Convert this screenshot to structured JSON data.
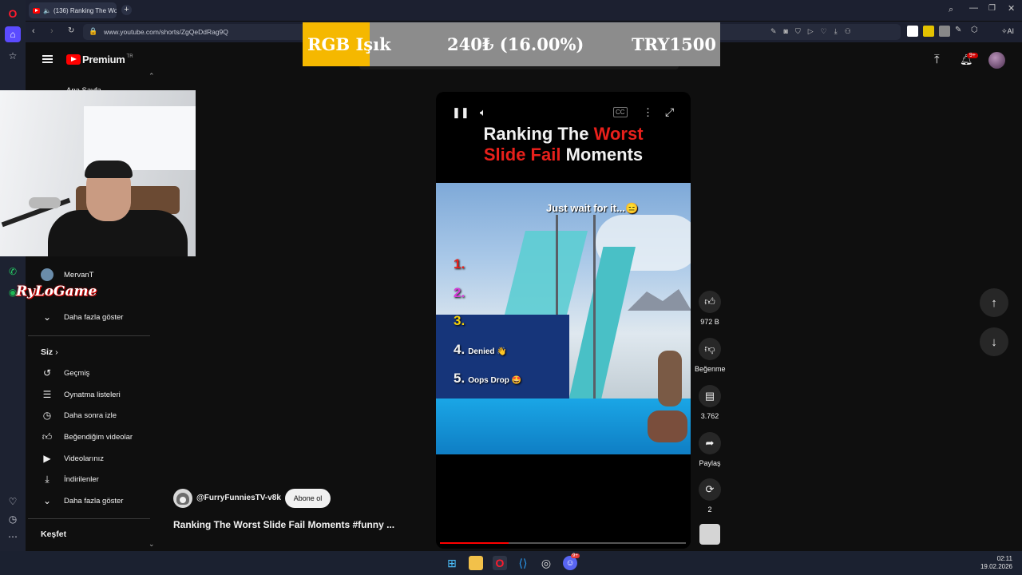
{
  "browser": {
    "tab_title": "(136) Ranking The Wo",
    "url": "www.youtube.com/shorts/ZgQeDdRag9Q",
    "ai_label": "AI"
  },
  "overlay_banner": {
    "label": "RGB Işık",
    "amount": "240₺ (16.00%)",
    "goal": "TRY1500",
    "progress_percent": 16,
    "colors": {
      "fill": "#f5b800",
      "track": "#8c8c8c"
    }
  },
  "youtube": {
    "brand": "Premium",
    "country": "TR",
    "notification_badge": "9+"
  },
  "sidebar": {
    "partial_top_item": "Ana Sayfa",
    "subscriptions": [
      {
        "label": "MervanT"
      }
    ],
    "show_more_1": "Daha fazla göster",
    "you_section_title": "Siz",
    "you_items": [
      {
        "icon": "history-icon",
        "label": "Geçmiş"
      },
      {
        "icon": "playlist-icon",
        "label": "Oynatma listeleri"
      },
      {
        "icon": "clock-icon",
        "label": "Daha sonra izle"
      },
      {
        "icon": "thumb-up-icon",
        "label": "Beğendiğim videolar"
      },
      {
        "icon": "video-icon",
        "label": "Videolarınız"
      },
      {
        "icon": "download-icon",
        "label": "İndirilenler"
      },
      {
        "icon": "chevron-down-icon",
        "label": "Daha fazla göster"
      }
    ],
    "explore_title": "Keşfet"
  },
  "stream_overlay": {
    "game_logo": "RyLoGame"
  },
  "player": {
    "title_line1_white": "Ranking The ",
    "title_line1_red": "Worst",
    "title_line2_red": "Slide Fail",
    "title_line2_white": " Moments",
    "caption": "Just wait for it...😑",
    "ranks": [
      {
        "num": "1.",
        "label": "",
        "color": "#e8201b"
      },
      {
        "num": "2.",
        "label": "",
        "color": "#d63bd8"
      },
      {
        "num": "3.",
        "label": "",
        "color": "#f4d10a"
      },
      {
        "num": "4.",
        "label": "Denied 👋",
        "color": "#ffffff"
      },
      {
        "num": "5.",
        "label": "Oops Drop 🤩",
        "color": "#ffffff"
      }
    ],
    "progress_fraction": 0.28
  },
  "actions": {
    "likes": "972 B",
    "dislike_label": "Beğenme",
    "comments": "3.762",
    "share_label": "Paylaş",
    "remix_count": "2"
  },
  "channel": {
    "handle": "@FurryFunniesTV-v8k",
    "subscribe_label": "Abone ol",
    "short_title": "Ranking The Worst Slide Fail Moments #funny ..."
  },
  "taskbar": {
    "time": "02:11",
    "date": "19.02.2026",
    "discord_badge": "9+"
  }
}
